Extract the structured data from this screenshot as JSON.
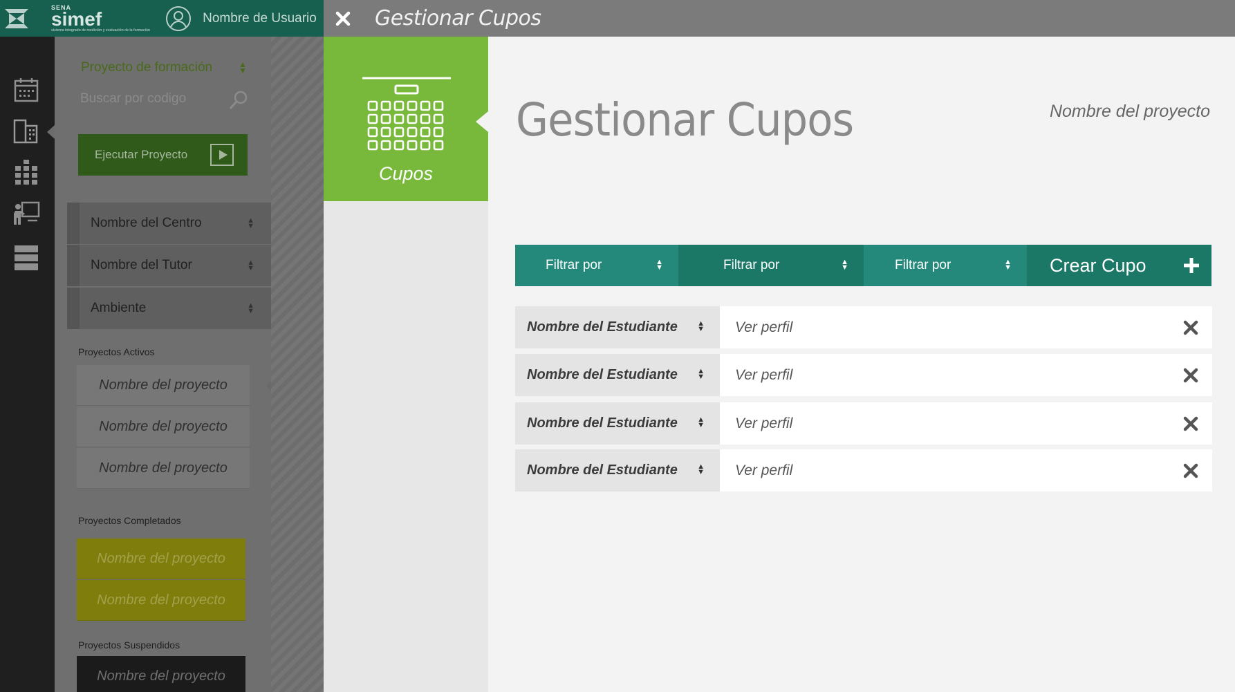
{
  "header": {
    "brand_top": "SENA",
    "brand_name": "simef",
    "brand_tagline": "sistema integrado de medición y evaluación de la formación",
    "user_name": "Nombre de  Usuario"
  },
  "rail": {
    "icons": [
      "calendar-icon",
      "building-icon",
      "grid-icon",
      "presentation-icon",
      "server-icon"
    ]
  },
  "sidebar": {
    "project_select": "Proyecto de formación",
    "search_placeholder": "Buscar por codigo",
    "execute_label": "Ejecutar Proyecto",
    "filters": [
      "Nombre del Centro",
      "Nombre del Tutor",
      "Ambiente"
    ],
    "active_label": "Proyectos Activos",
    "active": [
      "Nombre del proyecto",
      "Nombre del proyecto",
      "Nombre del proyecto"
    ],
    "completed_label": "Proyectos Completados",
    "completed": [
      "Nombre del proyecto",
      "Nombre del proyecto"
    ],
    "suspended_label": "Proyectos Suspendidos",
    "suspended": [
      "Nombre del proyecto"
    ]
  },
  "modal": {
    "title": "Gestionar Cupos",
    "module_label": "Cupos",
    "page_title": "Gestionar Cupos",
    "project_name": "Nombre del proyecto",
    "filters": [
      "Filtrar por",
      "Filtrar por",
      "Filtrar por"
    ],
    "create_label": "Crear Cupo",
    "rows": [
      {
        "student": "Nombre del Estudiante",
        "action": "Ver perfil"
      },
      {
        "student": "Nombre del Estudiante",
        "action": "Ver perfil"
      },
      {
        "student": "Nombre del Estudiante",
        "action": "Ver perfil"
      },
      {
        "student": "Nombre del Estudiante",
        "action": "Ver perfil"
      }
    ]
  },
  "colors": {
    "teal_dark": "#1b7766",
    "teal": "#24887a",
    "green": "#78b83a",
    "olive": "#7f7d0c",
    "header_bg": "#175f4f"
  }
}
